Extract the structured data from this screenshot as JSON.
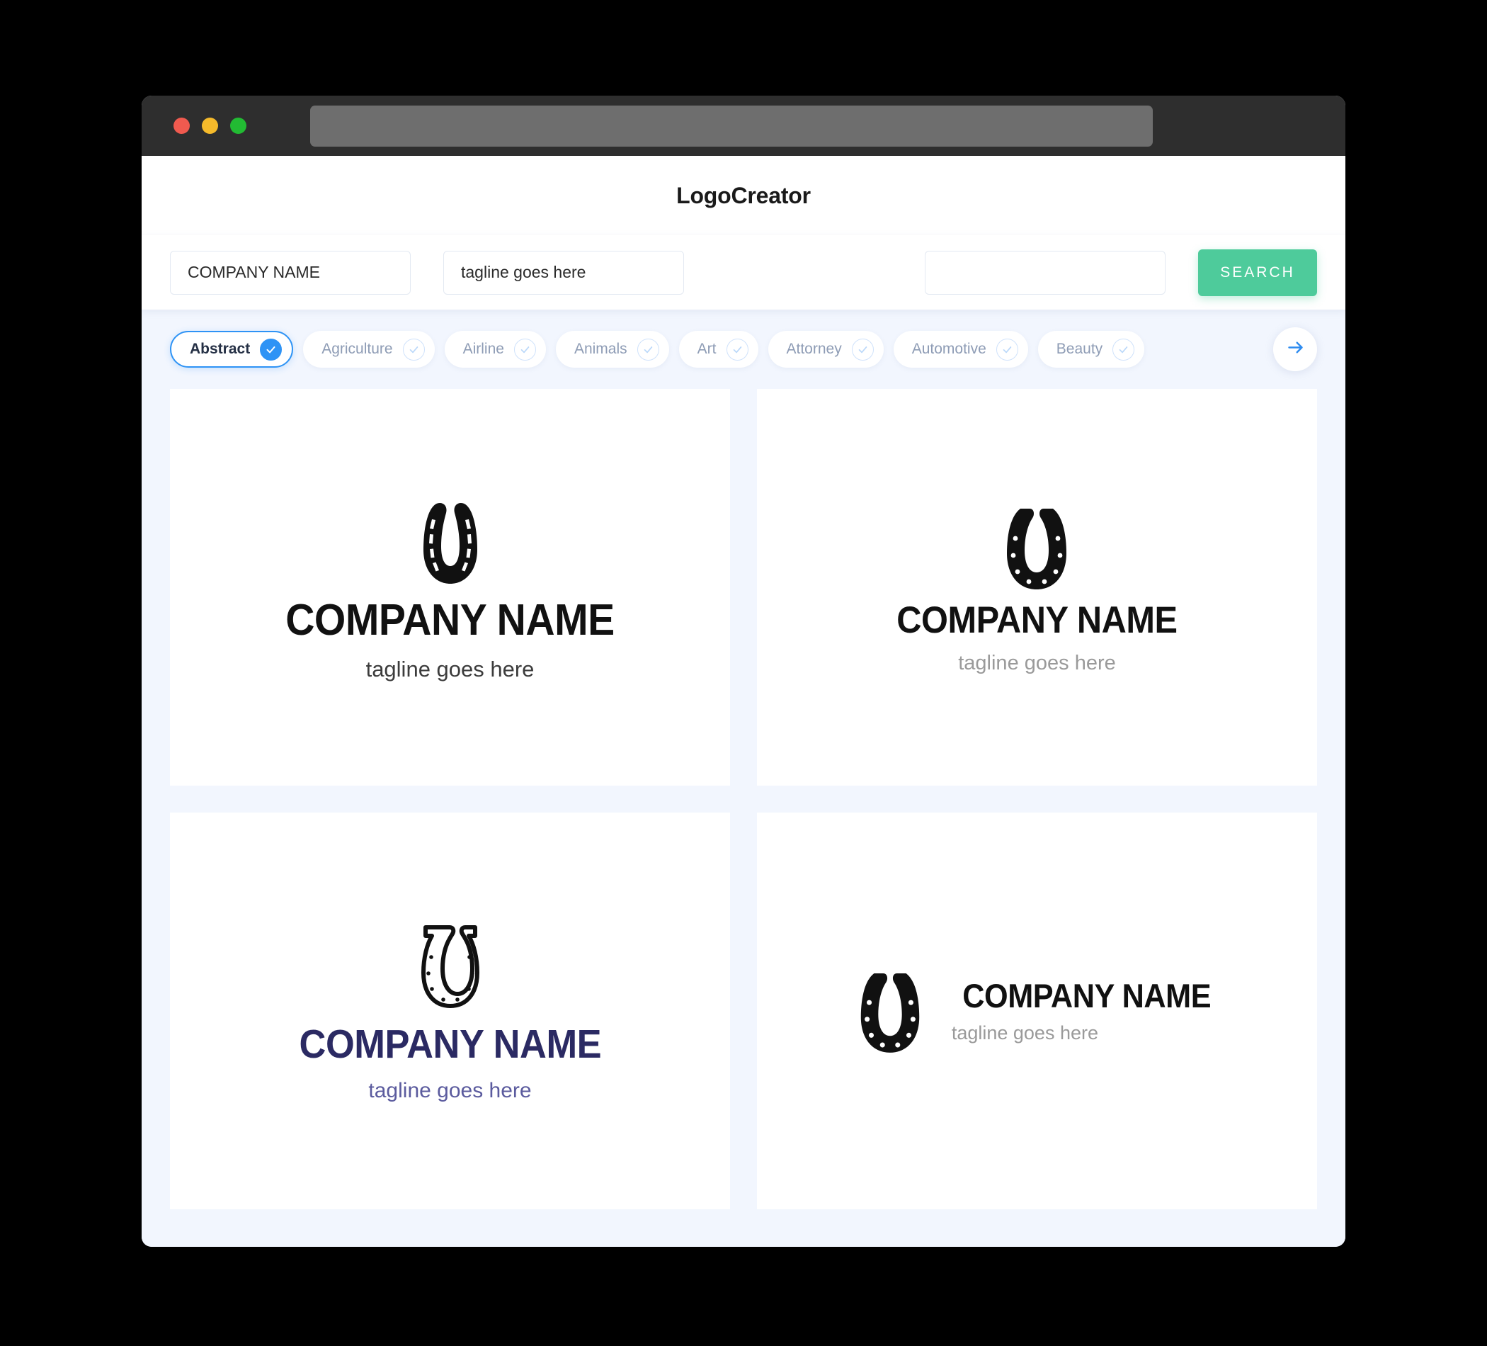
{
  "window": {
    "traffic_lights": [
      {
        "name": "close",
        "color": "#F05A4F"
      },
      {
        "name": "minimize",
        "color": "#F5BA2B"
      },
      {
        "name": "maximize",
        "color": "#22BB33"
      }
    ],
    "url_value": ""
  },
  "header": {
    "title": "LogoCreator"
  },
  "search": {
    "company_name_value": "COMPANY NAME",
    "company_name_placeholder": "COMPANY NAME",
    "tagline_value": "tagline goes here",
    "tagline_placeholder": "tagline goes here",
    "keyword_value": "",
    "keyword_placeholder": "",
    "search_label": "SEARCH",
    "search_color": "#4ECB9B"
  },
  "categories": {
    "next_icon": "arrow-right-icon",
    "accent_color": "#2E93F5",
    "items": [
      {
        "label": "Abstract",
        "selected": true
      },
      {
        "label": "Agriculture",
        "selected": false
      },
      {
        "label": "Airline",
        "selected": false
      },
      {
        "label": "Animals",
        "selected": false
      },
      {
        "label": "Art",
        "selected": false
      },
      {
        "label": "Attorney",
        "selected": false
      },
      {
        "label": "Automotive",
        "selected": false
      },
      {
        "label": "Beauty",
        "selected": false
      }
    ]
  },
  "logos": [
    {
      "mark": "horseshoe-solid-dashes-icon",
      "name": "COMPANY NAME",
      "tagline": "tagline goes here",
      "name_color": "#111111",
      "tagline_color": "#3C3C3C",
      "layout": "stacked"
    },
    {
      "mark": "horseshoe-solid-holes-icon",
      "name": "COMPANY NAME",
      "tagline": "tagline goes here",
      "name_color": "#111111",
      "tagline_color": "#9A9A9A",
      "layout": "stacked"
    },
    {
      "mark": "horseshoe-outline-icon",
      "name": "COMPANY NAME",
      "tagline": "tagline goes here",
      "name_color": "#2B2A63",
      "tagline_color": "#5B5B9E",
      "layout": "stacked"
    },
    {
      "mark": "horseshoe-solid-holes-icon",
      "name": "COMPANY NAME",
      "tagline": "tagline goes here",
      "name_color": "#111111",
      "tagline_color": "#9A9A9A",
      "layout": "horizontal"
    }
  ]
}
